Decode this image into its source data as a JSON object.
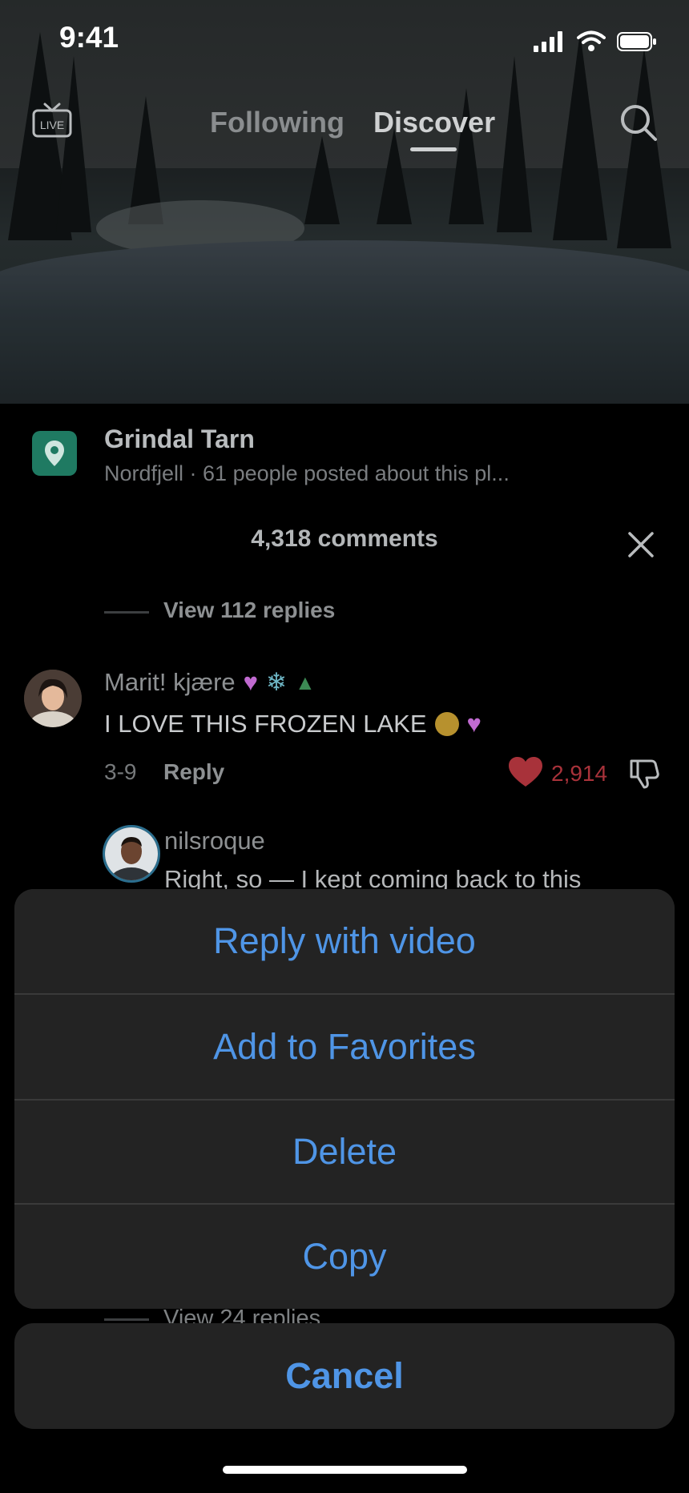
{
  "status_bar": {
    "time": "9:41"
  },
  "top_nav": {
    "tabs": [
      "Following",
      "Discover"
    ],
    "active_tab": "Discover"
  },
  "location": {
    "title": "Grindal Tarn",
    "subtitle": "Nordfjell · 61 people posted about this pl..."
  },
  "comments": {
    "count_label": "4,318 comments",
    "view_replies_top": "View 112 replies",
    "main_comment": {
      "author": "Marit! kjære",
      "text": "I LOVE THIS FROZEN LAKE",
      "date": "3-9",
      "reply_label": "Reply",
      "likes": "2,914"
    },
    "reply": {
      "author": "nilsroque",
      "text": "Right, so — I kept coming back to this"
    },
    "view_replies_bottom": "View 24 replies"
  },
  "action_sheet": {
    "items": [
      "Reply with video",
      "Add to Favorites",
      "Delete",
      "Copy"
    ],
    "cancel_label": "Cancel"
  },
  "colors": {
    "accent": "#4f95e6",
    "like": "#a8323a",
    "sheet_bg": "#232323"
  }
}
